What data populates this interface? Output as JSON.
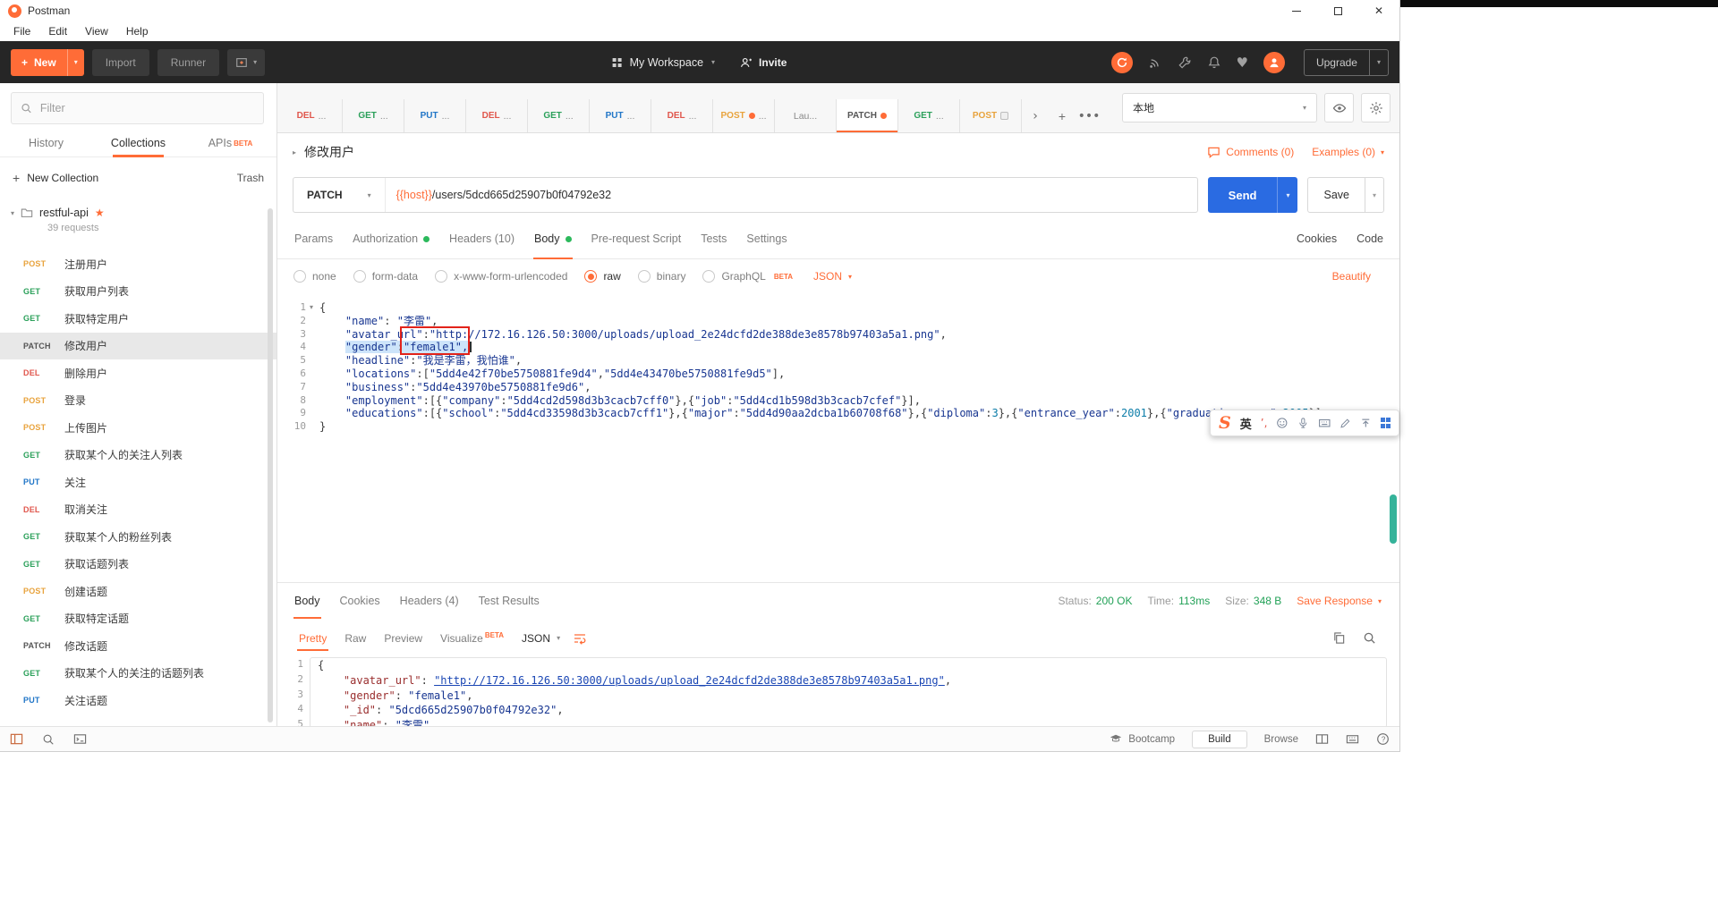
{
  "ui": {
    "beta_label": "BETA",
    "accent": "#FF6C37"
  },
  "window": {
    "title": "Postman",
    "menus": [
      "File",
      "Edit",
      "View",
      "Help"
    ]
  },
  "toolbar": {
    "new_label": "New",
    "import_label": "Import",
    "runner_label": "Runner",
    "workspace_label": "My Workspace",
    "invite_label": "Invite",
    "upgrade_label": "Upgrade"
  },
  "sidebar": {
    "filter_placeholder": "Filter",
    "tabs": [
      {
        "label": "History",
        "active": false,
        "beta": false
      },
      {
        "label": "Collections",
        "active": true,
        "beta": false
      },
      {
        "label": "APIs",
        "active": false,
        "beta": true
      }
    ],
    "new_collection_label": "New Collection",
    "trash_label": "Trash",
    "collection": {
      "name": "restful-api",
      "starred": true,
      "meta": "39 requests"
    },
    "requests": [
      {
        "method": "POST",
        "name": "注册用户"
      },
      {
        "method": "GET",
        "name": "获取用户列表"
      },
      {
        "method": "GET",
        "name": "获取特定用户"
      },
      {
        "method": "PATCH",
        "name": "修改用户",
        "selected": true
      },
      {
        "method": "DEL",
        "name": "删除用户"
      },
      {
        "method": "POST",
        "name": "登录"
      },
      {
        "method": "POST",
        "name": "上传图片"
      },
      {
        "method": "GET",
        "name": "获取某个人的关注人列表"
      },
      {
        "method": "PUT",
        "name": "关注"
      },
      {
        "method": "DEL",
        "name": "取消关注"
      },
      {
        "method": "GET",
        "name": "获取某个人的粉丝列表"
      },
      {
        "method": "GET",
        "name": "获取话题列表"
      },
      {
        "method": "POST",
        "name": "创建话题"
      },
      {
        "method": "GET",
        "name": "获取特定话题"
      },
      {
        "method": "PATCH",
        "name": "修改话题"
      },
      {
        "method": "GET",
        "name": "获取某个人的关注的话题列表"
      },
      {
        "method": "PUT",
        "name": "关注话题"
      }
    ]
  },
  "tabstrip": {
    "environment": "本地",
    "tabs": [
      {
        "method": "DEL",
        "label": "..."
      },
      {
        "method": "GET",
        "label": "..."
      },
      {
        "method": "PUT",
        "label": "..."
      },
      {
        "method": "DEL",
        "label": "..."
      },
      {
        "method": "GET",
        "label": "..."
      },
      {
        "method": "PUT",
        "label": "..."
      },
      {
        "method": "DEL",
        "label": "..."
      },
      {
        "method": "POST",
        "label": "...",
        "dirty": true
      },
      {
        "method": "",
        "label": "Lau..."
      },
      {
        "method": "PATCH",
        "label": "",
        "dirty": true,
        "active": true
      },
      {
        "method": "GET",
        "label": "..."
      },
      {
        "method": "POST",
        "label": "",
        "badge": true
      }
    ]
  },
  "request": {
    "name": "修改用户",
    "comments_label": "Comments (0)",
    "examples_label": "Examples (0)",
    "method": "PATCH",
    "url_host": "{{host}}",
    "url_path": "/users/5dcd665d25907b0f04792e32",
    "send_label": "Send",
    "save_label": "Save",
    "tabs": [
      {
        "label": "Params"
      },
      {
        "label": "Authorization",
        "dot": true
      },
      {
        "label": "Headers (10)"
      },
      {
        "label": "Body",
        "dot": true,
        "active": true
      },
      {
        "label": "Pre-request Script"
      },
      {
        "label": "Tests"
      },
      {
        "label": "Settings"
      }
    ],
    "cookies_label": "Cookies",
    "code_label": "Code",
    "body_types": [
      {
        "label": "none"
      },
      {
        "label": "form-data"
      },
      {
        "label": "x-www-form-urlencoded"
      },
      {
        "label": "raw",
        "selected": true
      },
      {
        "label": "binary"
      },
      {
        "label": "GraphQL",
        "beta": true
      }
    ],
    "format": "JSON",
    "beautify_label": "Beautify"
  },
  "editor": {
    "lines": [
      {
        "tokens": [
          [
            "{",
            "p"
          ]
        ]
      },
      {
        "tokens": [
          [
            "    ",
            "p"
          ],
          [
            "\"name\"",
            "k"
          ],
          [
            ": ",
            "p"
          ],
          [
            "\"李雷\"",
            "s"
          ],
          [
            ",",
            "p"
          ]
        ]
      },
      {
        "tokens": [
          [
            "    ",
            "p"
          ],
          [
            "\"avatar_url\"",
            "k"
          ],
          [
            ":",
            "p"
          ],
          [
            "\"http://172.16.126.50:3000/uploads/upload_2e24dcfd2de388de3e8578b97403a5a1.png\"",
            "s"
          ],
          [
            ",",
            "p"
          ]
        ]
      },
      {
        "tokens": [
          [
            "    ",
            "p"
          ],
          [
            "\"gender\"",
            "k sel"
          ],
          [
            ":",
            "p sel"
          ],
          [
            "\"female1\",",
            "s sel boxed"
          ],
          [
            "",
            "cursor"
          ]
        ]
      },
      {
        "tokens": [
          [
            "    ",
            "p"
          ],
          [
            "\"headline\"",
            "k"
          ],
          [
            ":",
            "p"
          ],
          [
            "\"我是李雷，我怕谁\"",
            "s"
          ],
          [
            ",",
            "p"
          ]
        ]
      },
      {
        "tokens": [
          [
            "    ",
            "p"
          ],
          [
            "\"locations\"",
            "k"
          ],
          [
            ":[",
            "p"
          ],
          [
            "\"5dd4e42f70be5750881fe9d4\"",
            "s"
          ],
          [
            ",",
            "p"
          ],
          [
            "\"5dd4e43470be5750881fe9d5\"",
            "s"
          ],
          [
            "],",
            "p"
          ]
        ]
      },
      {
        "tokens": [
          [
            "    ",
            "p"
          ],
          [
            "\"business\"",
            "k"
          ],
          [
            ":",
            "p"
          ],
          [
            "\"5dd4e43970be5750881fe9d6\"",
            "s"
          ],
          [
            ",",
            "p"
          ]
        ]
      },
      {
        "tokens": [
          [
            "    ",
            "p"
          ],
          [
            "\"employment\"",
            "k"
          ],
          [
            ":[{",
            "p"
          ],
          [
            "\"company\"",
            "k"
          ],
          [
            ":",
            "p"
          ],
          [
            "\"5dd4cd2d598d3b3cacb7cff0\"",
            "s"
          ],
          [
            "},{",
            "p"
          ],
          [
            "\"job\"",
            "k"
          ],
          [
            ":",
            "p"
          ],
          [
            "\"5dd4cd1b598d3b3cacb7cfef\"",
            "s"
          ],
          [
            "}],",
            "p"
          ]
        ]
      },
      {
        "tokens": [
          [
            "    ",
            "p"
          ],
          [
            "\"educations\"",
            "k"
          ],
          [
            ":[{",
            "p"
          ],
          [
            "\"school\"",
            "k"
          ],
          [
            ":",
            "p"
          ],
          [
            "\"5dd4cd33598d3b3cacb7cff1\"",
            "s"
          ],
          [
            "},{",
            "p"
          ],
          [
            "\"major\"",
            "k"
          ],
          [
            ":",
            "p"
          ],
          [
            "\"5dd4d90aa2dcba1b60708f68\"",
            "s"
          ],
          [
            "},{",
            "p"
          ],
          [
            "\"diploma\"",
            "k"
          ],
          [
            ":",
            "p"
          ],
          [
            "3",
            "n"
          ],
          [
            "},{",
            "p"
          ],
          [
            "\"entrance_year\"",
            "k"
          ],
          [
            ":",
            "p"
          ],
          [
            "2001",
            "n"
          ],
          [
            "},{",
            "p"
          ],
          [
            "\"graduation_year\"",
            "k"
          ],
          [
            ":",
            "p"
          ],
          [
            "2005",
            "n"
          ],
          [
            "}],",
            "p"
          ]
        ]
      },
      {
        "tokens": [
          [
            "}",
            "p"
          ]
        ]
      }
    ]
  },
  "response": {
    "tabs": [
      {
        "label": "Body",
        "active": true
      },
      {
        "label": "Cookies"
      },
      {
        "label": "Headers (4)"
      },
      {
        "label": "Test Results"
      }
    ],
    "status_label": "Status:",
    "status_value": "200 OK",
    "time_label": "Time:",
    "time_value": "113ms",
    "size_label": "Size:",
    "size_value": "348 B",
    "save_response_label": "Save Response",
    "views": [
      {
        "label": "Pretty",
        "active": true
      },
      {
        "label": "Raw"
      },
      {
        "label": "Preview"
      },
      {
        "label": "Visualize",
        "beta": true
      }
    ],
    "format": "JSON",
    "lines": [
      {
        "tokens": [
          [
            "{",
            "p"
          ]
        ]
      },
      {
        "tokens": [
          [
            "    ",
            "p"
          ],
          [
            "\"avatar_url\"",
            "k"
          ],
          [
            ": ",
            "p"
          ],
          [
            "\"http://172.16.126.50:3000/uploads/upload_2e24dcfd2de388de3e8578b97403a5a1.png\"",
            "l"
          ],
          [
            ",",
            "p"
          ]
        ]
      },
      {
        "tokens": [
          [
            "    ",
            "p"
          ],
          [
            "\"gender\"",
            "k"
          ],
          [
            ": ",
            "p"
          ],
          [
            "\"female1\"",
            "s"
          ],
          [
            ",",
            "p"
          ]
        ]
      },
      {
        "tokens": [
          [
            "    ",
            "p"
          ],
          [
            "\"_id\"",
            "k"
          ],
          [
            ": ",
            "p"
          ],
          [
            "\"5dcd665d25907b0f04792e32\"",
            "s"
          ],
          [
            ",",
            "p"
          ]
        ]
      },
      {
        "tokens": [
          [
            "    ",
            "p"
          ],
          [
            "\"name\"",
            "k"
          ],
          [
            ": ",
            "p"
          ],
          [
            "\"李雷\"",
            "s"
          ],
          [
            ",",
            "p"
          ]
        ]
      }
    ]
  },
  "statusbar": {
    "bootcamp_label": "Bootcamp",
    "build_label": "Build",
    "browse_label": "Browse"
  },
  "ime": {
    "logo": "S",
    "lang": "英",
    "punc": "’,"
  }
}
